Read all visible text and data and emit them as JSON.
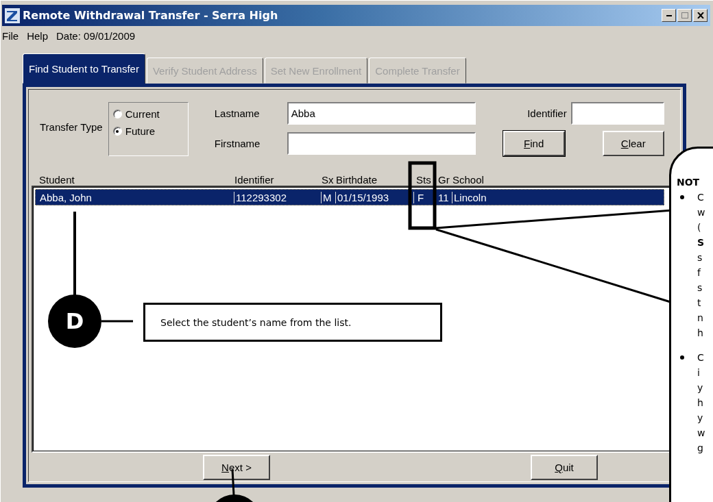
{
  "window": {
    "title": "Remote Withdrawal Transfer - Serra High"
  },
  "menu": [
    {
      "label": "File"
    },
    {
      "label": "Help"
    }
  ],
  "date": "Date: 09/01/2009",
  "tabs": [
    {
      "label": "Find Student to Transfer",
      "selected": true,
      "disabled": false
    },
    {
      "label": "Verify Student Address",
      "selected": false,
      "disabled": true
    },
    {
      "label": "Set New Enrollment",
      "selected": false,
      "disabled": true
    },
    {
      "label": "Complete Transfer",
      "selected": false,
      "disabled": true
    }
  ],
  "transfer_type": {
    "label": "Transfer Type",
    "options": [
      {
        "label": "Current",
        "selected": false
      },
      {
        "label": "Future",
        "selected": true
      }
    ]
  },
  "name_fields": [
    {
      "label": "Lastname",
      "value": "Abba"
    },
    {
      "label": "Firstname"
    }
  ],
  "identifier_field": {
    "label": "Identifier"
  },
  "search_buttons": [
    {
      "key": "F",
      "rest": "ind",
      "default": true
    },
    {
      "key": "C",
      "rest": "lear",
      "default": false
    }
  ],
  "list": {
    "columns": [
      "Student",
      "Identifier",
      "Sx",
      "Birthdate",
      "Sts",
      "Gr",
      "School"
    ],
    "rows": [
      {
        "cells": [
          "Abba, John",
          "112293302",
          "M",
          "01/15/1993",
          "F",
          "11",
          "Lincoln"
        ],
        "selected": true
      }
    ]
  },
  "bottom_buttons": [
    {
      "key": "N",
      "rest": "ext >"
    },
    {
      "key": "Q",
      "rest": "uit"
    }
  ],
  "annotations": {
    "step_marker": "D",
    "callout": "Select the student’s name from the list.",
    "note": {
      "heading": "NOT",
      "bullets": [
        [
          "C",
          "w",
          "(",
          "**S**",
          "s",
          "f",
          "s",
          "t",
          "n",
          "h"
        ],
        [
          "C",
          "i",
          "y",
          "h",
          "y",
          "w",
          "g"
        ]
      ]
    }
  }
}
